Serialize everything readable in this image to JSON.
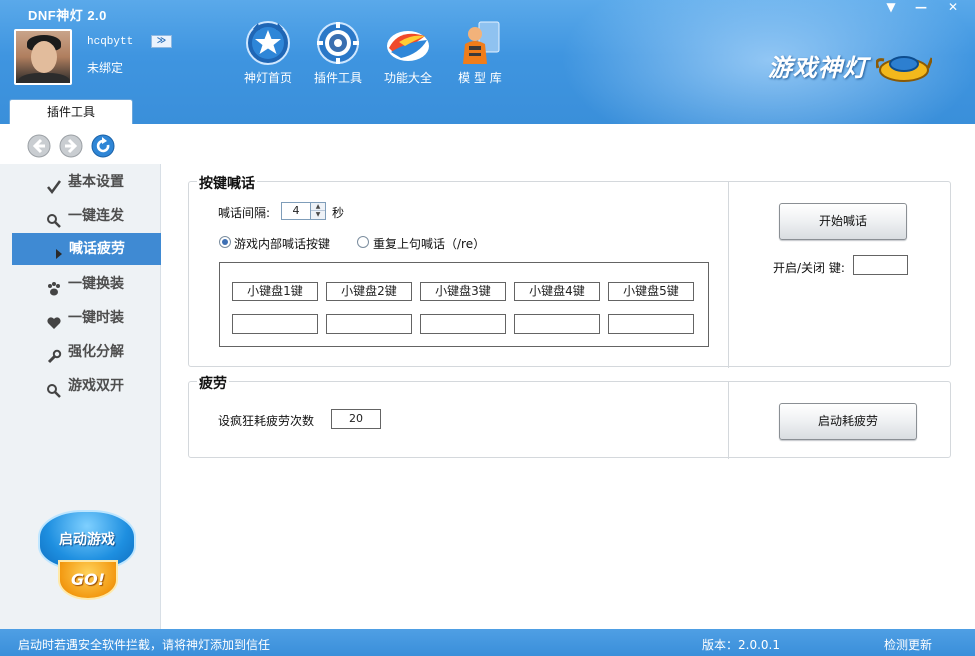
{
  "window": {
    "title": "DNF神灯  2.0",
    "controls": {
      "menu": "▼",
      "minimize": "—",
      "close": "✕"
    }
  },
  "user": {
    "name": "hcqbytt",
    "status": "未绑定",
    "expand": "≫"
  },
  "nav": [
    {
      "label": "神灯首页",
      "icon": "star-icon"
    },
    {
      "label": "插件工具",
      "icon": "gear-icon"
    },
    {
      "label": "功能大全",
      "icon": "swirl-icon"
    },
    {
      "label": "模 型 库",
      "icon": "character-icon"
    }
  ],
  "brand": {
    "text": "游戏神灯"
  },
  "tabs": {
    "active": "插件工具"
  },
  "toolbar": {
    "back": "back-icon",
    "forward": "forward-icon",
    "refresh": "refresh-icon"
  },
  "sidebar": {
    "items": [
      {
        "label": "基本设置",
        "icon": "check-icon",
        "active": false
      },
      {
        "label": "一键连发",
        "icon": "magnifier-icon",
        "active": false
      },
      {
        "label": "喊话疲劳",
        "icon": "arrow-right-icon",
        "active": true
      },
      {
        "label": "一键换装",
        "icon": "paw-icon",
        "active": false
      },
      {
        "label": "一键时装",
        "icon": "heart-icon",
        "active": false
      },
      {
        "label": "强化分解",
        "icon": "wrench-icon",
        "active": false
      },
      {
        "label": "游戏双开",
        "icon": "magnifier-icon",
        "active": false
      }
    ],
    "launch": {
      "label": "启动游戏",
      "go": "GO!"
    }
  },
  "shout": {
    "title": "按键喊话",
    "interval_label": "喊话间隔:",
    "interval_value": "4",
    "interval_unit": "秒",
    "radio_game": "游戏内部喊话按键",
    "radio_repeat": "重复上句喊话（/re）",
    "selected_mode": "game",
    "keys": [
      "小键盘1键",
      "小键盘2键",
      "小键盘3键",
      "小键盘4键",
      "小键盘5键"
    ],
    "key_values": [
      "",
      "",
      "",
      "",
      ""
    ],
    "start_button": "开始喊话",
    "hotkey_label": "开启/关闭 键:",
    "hotkey_value": ""
  },
  "fatigue": {
    "title": "疲劳",
    "count_label": "设疯狂耗疲劳次数",
    "count_value": "20",
    "start_button": "启动耗疲劳"
  },
  "status": {
    "message": "启动时若遇安全软件拦截，请将神灯添加到信任",
    "version": "版本：2.0.0.1",
    "update": "检测更新"
  }
}
